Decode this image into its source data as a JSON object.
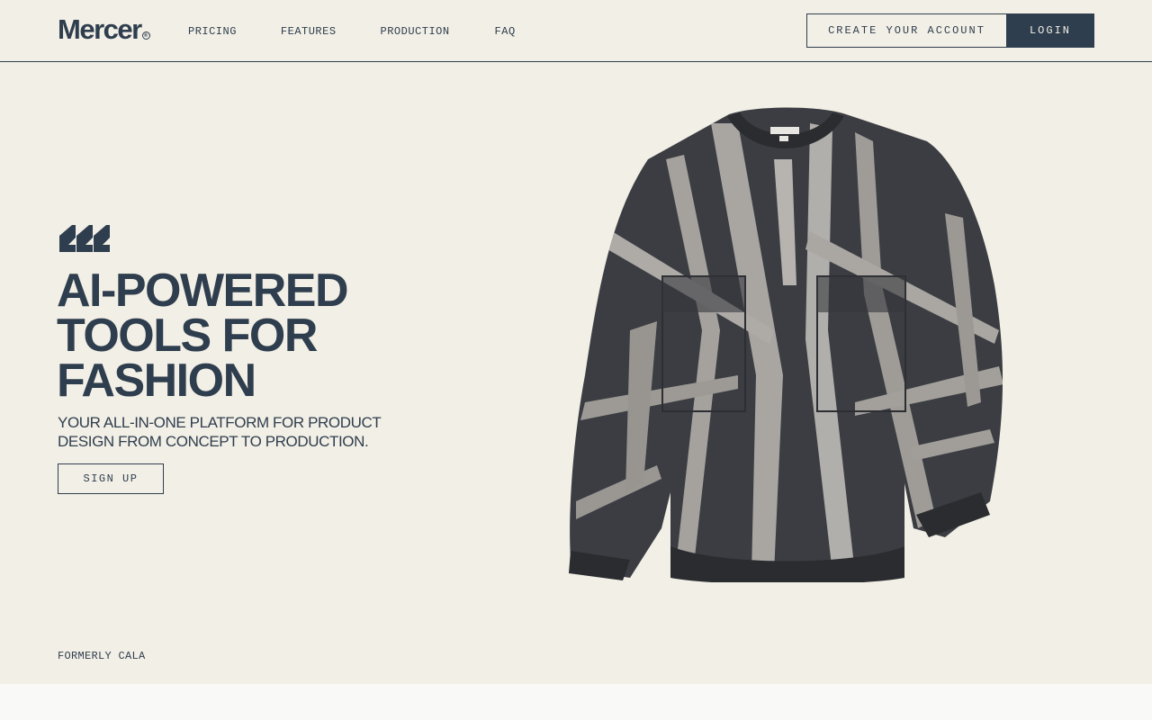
{
  "brand": {
    "logo_text": "Mercer",
    "logo_mark": "®",
    "color": "#2f3e4e",
    "background": "#f2efe6"
  },
  "nav": {
    "items": [
      {
        "label": "PRICING"
      },
      {
        "label": "FEATURES"
      },
      {
        "label": "PRODUCTION"
      },
      {
        "label": "FAQ"
      }
    ]
  },
  "header_actions": {
    "create_account_label": "CREATE YOUR ACCOUNT",
    "login_label": "LOGIN"
  },
  "hero": {
    "brand_mark_icon": "triple-slash-logo-icon",
    "headline_lines": [
      "AI-POWERED",
      "TOOLS FOR",
      "FASHION"
    ],
    "subheading": "YOUR ALL-IN-ONE PLATFORM FOR PRODUCT DESIGN FROM CONCEPT TO PRODUCTION.",
    "signup_label": "SIGN UP",
    "product_image": "tie-dye-sweatshirt-image",
    "formerly_text": "FORMERLY CALA"
  }
}
